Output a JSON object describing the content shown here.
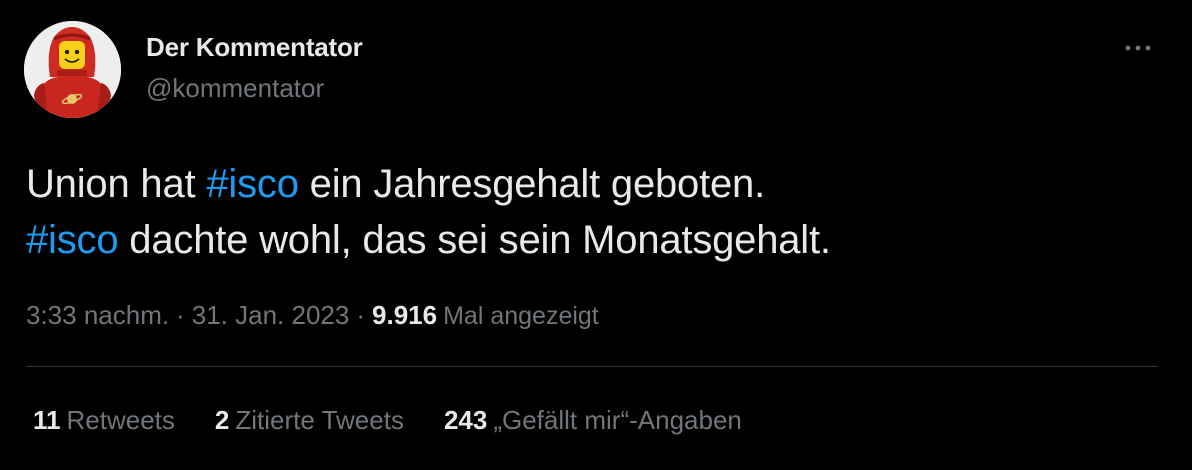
{
  "author": {
    "display_name": "Der Kommentator",
    "handle": "@kommentator",
    "avatar_icon": "lego-astronaut-avatar"
  },
  "tweet": {
    "lines": [
      [
        {
          "type": "text",
          "text": "Union hat "
        },
        {
          "type": "hashtag",
          "text": "#isco"
        },
        {
          "type": "text",
          "text": " ein Jahresgehalt geboten."
        }
      ],
      [
        {
          "type": "hashtag",
          "text": "#isco"
        },
        {
          "type": "text",
          "text": " dachte wohl, das sei sein Monatsgehalt."
        }
      ]
    ]
  },
  "meta": {
    "time": "3:33 nachm.",
    "separator": "·",
    "date": "31. Jan. 2023",
    "views_count": "9.916",
    "views_label": "Mal angezeigt"
  },
  "stats": {
    "retweets_count": "11",
    "retweets_label": "Retweets",
    "quotes_count": "2",
    "quotes_label": "Zitierte Tweets",
    "likes_count": "243",
    "likes_label": "„Gefällt mir“-Angaben"
  },
  "icons": {
    "more": "more-horizontal-icon"
  },
  "colors": {
    "background": "#000000",
    "primary_text": "#e7e9ea",
    "secondary_text": "#71767b",
    "link": "#1d9bf0",
    "divider": "#2f3336"
  }
}
